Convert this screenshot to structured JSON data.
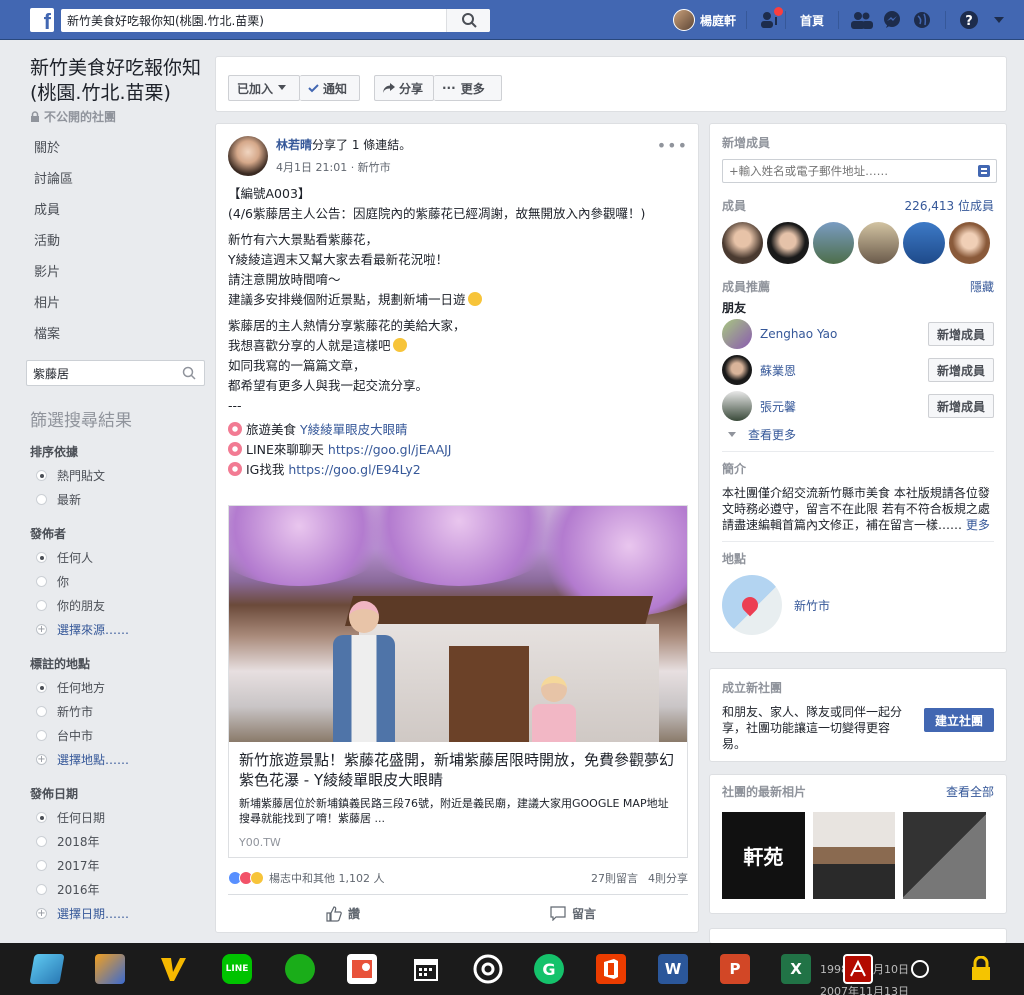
{
  "topbar": {
    "logo": "f",
    "search_value": "新竹美食好吃報你知(桃園.竹北.苗栗)",
    "user_name": "楊庭軒",
    "home_label": "首頁"
  },
  "left": {
    "group_title": "新竹美食好吃報你知(桃園.竹北.苗栗)",
    "group_type": "不公開的社團",
    "nav": [
      "關於",
      "討論區",
      "成員",
      "活動",
      "影片",
      "相片",
      "檔案"
    ],
    "search_value": "紫藤居",
    "filter_title": "篩選搜尋結果",
    "filters": [
      {
        "head": "排序依據",
        "options": [
          {
            "label": "熱門貼文",
            "selected": true
          },
          {
            "label": "最新",
            "selected": false
          }
        ]
      },
      {
        "head": "發佈者",
        "options": [
          {
            "label": "任何人",
            "selected": true
          },
          {
            "label": "你",
            "selected": false
          },
          {
            "label": "你的朋友",
            "selected": false
          }
        ],
        "more": "選擇來源……"
      },
      {
        "head": "標註的地點",
        "options": [
          {
            "label": "任何地方",
            "selected": true
          },
          {
            "label": "新竹市",
            "selected": false
          },
          {
            "label": "台中市",
            "selected": false
          }
        ],
        "more": "選擇地點……"
      },
      {
        "head": "發佈日期",
        "options": [
          {
            "label": "任何日期",
            "selected": true
          },
          {
            "label": "2018年",
            "selected": false
          },
          {
            "label": "2017年",
            "selected": false
          },
          {
            "label": "2016年",
            "selected": false
          }
        ],
        "more": "選擇日期……"
      }
    ]
  },
  "actionbar": {
    "joined": "已加入",
    "notify": "通知",
    "share": "分享",
    "more": "更多"
  },
  "post": {
    "author": "林若晴",
    "author_suffix": "分享了 1 條連結。",
    "time": "4月1日 21:01 · 新竹市",
    "lines": [
      "【編號A003】",
      "(4/6紫藤居主人公告：因庭院內的紫藤花已經凋謝，故無開放入內參觀囉！)",
      "新竹有六大景點看紫藤花，",
      "Y綾綾這週末又幫大家去看最新花況啦！",
      "請注意開放時間唷～",
      "建議多安排幾個附近景點，規劃新埔一日遊",
      "紫藤居的主人熱情分享紫藤花的美給大家，",
      "我想喜歡分享的人就是這樣吧",
      "如同我寫的一篇篇文章，",
      "都希望有更多人與我一起交流分享。",
      "---"
    ],
    "links": [
      {
        "prefix": "旅遊美食",
        "text": "Y綾綾單眼皮大眼睛"
      },
      {
        "prefix": "LINE來聊聊天",
        "text": "https://goo.gl/jEAAJJ"
      },
      {
        "prefix": "IG找我",
        "text": "https://goo.gl/E94Ly2"
      }
    ],
    "card": {
      "title": "新竹旅遊景點！紫藤花盛開，新埔紫藤居限時開放，免費參觀夢幻紫色花瀑 - Y綾綾單眼皮大眼睛",
      "desc": "新埔紫藤居位於新埔鎮義民路三段76號，附近是義民廟，建議大家用GOOGLE MAP地址搜尋就能找到了唷！紫藤居 ...",
      "domain": "Y00.TW"
    },
    "reactions_text": "楊志中和其他 1,102 人",
    "comments": "27則留言",
    "shares": "4則分享",
    "like_label": "讚",
    "comment_label": "留言"
  },
  "right": {
    "add_members_head": "新增成員",
    "add_placeholder": "+輸入姓名或電子郵件地址……",
    "members_head": "成員",
    "members_count": "226,413 位成員",
    "suggest_head": "成員推薦",
    "hide": "隱藏",
    "friends_head": "朋友",
    "friends": [
      {
        "name": "Zenghao Yao",
        "btn": "新增成員"
      },
      {
        "name": "蘇業恩",
        "btn": "新增成員"
      },
      {
        "name": "張元馨",
        "btn": "新增成員"
      }
    ],
    "see_more": "查看更多",
    "about_head": "簡介",
    "about_text": "本社團僅介紹交流新竹縣市美食 本社版規請各位發文時務必遵守，留言不在此限 若有不符合板規之處請盡速編輯首篇內文修正，補在留言一樣……",
    "about_more": "更多",
    "location_head": "地點",
    "location": "新竹市",
    "create_head": "成立新社團",
    "create_text": "和朋友、家人、隊友或同伴一起分享，社團功能讓這一切變得更容易。",
    "create_btn": "建立社團",
    "photos_head": "社團的最新相片",
    "see_all": "查看全部",
    "photo_caption": "軒苑"
  },
  "taskbar": {
    "overlay1": "1998年10月10日",
    "overlay2": "2007年11月13日"
  }
}
